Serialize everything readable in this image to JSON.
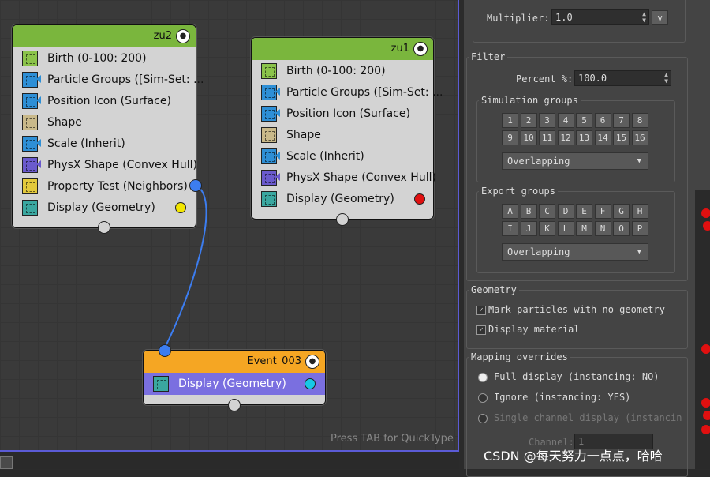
{
  "graph": {
    "quicktype_hint": "Press TAB for QuickType",
    "nodes": {
      "zu2": {
        "title": "zu2",
        "operators": [
          "Birth (0-100: 200)",
          "Particle Groups ([Sim-Set: ...",
          "Position Icon (Surface)",
          "Shape",
          "Scale (Inherit)",
          "PhysX Shape (Convex Hull)",
          "Property Test (Neighbors)",
          "Display (Geometry)"
        ]
      },
      "zu1": {
        "title": "zu1",
        "operators": [
          "Birth (0-100: 200)",
          "Particle Groups ([Sim-Set: ...",
          "Position Icon (Surface)",
          "Shape",
          "Scale (Inherit)",
          "PhysX Shape (Convex Hull)",
          "Display (Geometry)"
        ]
      },
      "event": {
        "title": "Event_003",
        "operators": [
          "Display (Geometry)"
        ]
      }
    },
    "colors": {
      "header_green": "#7ab63d",
      "header_orange": "#f5a623",
      "wire": "#3c7df0",
      "selected_row": "#7a6fe0"
    }
  },
  "panel": {
    "top": {
      "multiplier_label": "Multiplier:",
      "multiplier_value": "1.0",
      "v_button": "v"
    },
    "filter": {
      "label": "Filter",
      "percent_label": "Percent %:",
      "percent_value": "100.0",
      "sim_groups": {
        "label": "Simulation groups",
        "buttons": [
          "1",
          "2",
          "3",
          "4",
          "5",
          "6",
          "7",
          "8",
          "9",
          "10",
          "11",
          "12",
          "13",
          "14",
          "15",
          "16"
        ],
        "mode": "Overlapping"
      },
      "export_groups": {
        "label": "Export groups",
        "buttons": [
          "A",
          "B",
          "C",
          "D",
          "E",
          "F",
          "G",
          "H",
          "I",
          "J",
          "K",
          "L",
          "M",
          "N",
          "O",
          "P"
        ],
        "mode": "Overlapping"
      }
    },
    "geometry": {
      "label": "Geometry",
      "mark_no_geometry": "Mark particles with no geometry",
      "display_material": "Display material"
    },
    "mapping": {
      "label": "Mapping overrides",
      "full_display": "Full display (instancing: NO)",
      "ignore": "Ignore (instancing: YES)",
      "single_channel": "Single channel display (instancin",
      "channel_label": "Channel:",
      "channel_value": "1"
    }
  },
  "watermark": "CSDN @每天努力一点点，哈哈"
}
